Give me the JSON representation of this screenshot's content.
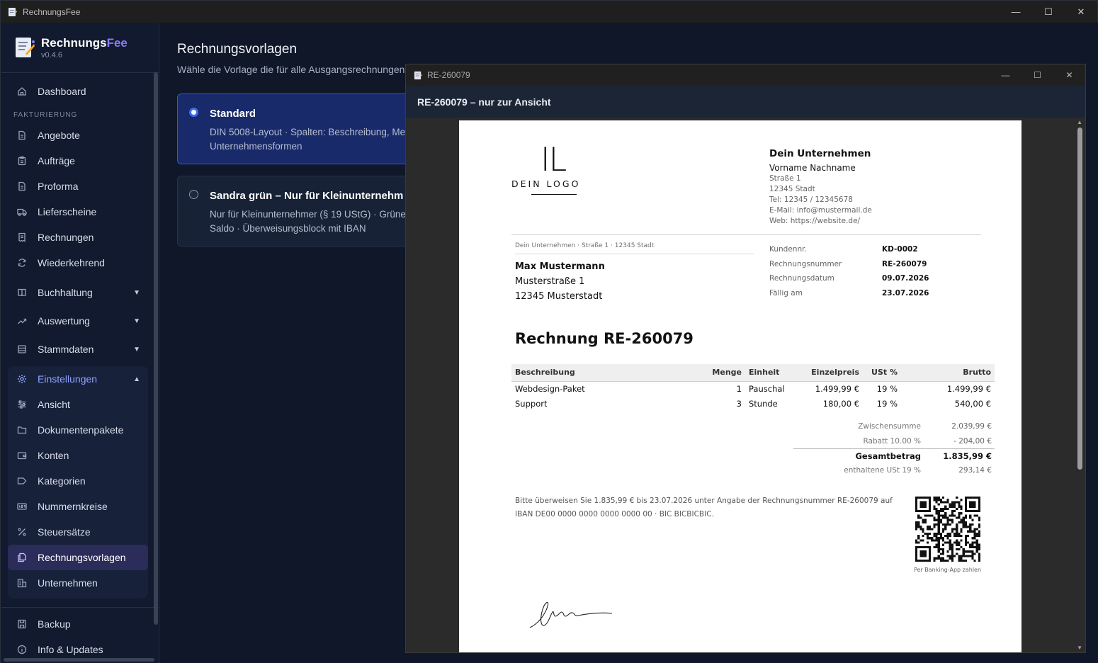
{
  "app": {
    "window_title": "RechnungsFee",
    "brand_primary": "Rechnungs",
    "brand_accent": "Fee",
    "version": "v0.4.6",
    "accent_color": "#8b7cf6"
  },
  "sidebar": {
    "top_items": [
      {
        "label": "Dashboard",
        "icon": "home-icon"
      }
    ],
    "section_label": "FAKTURIERUNG",
    "billing_items": [
      {
        "label": "Angebote",
        "icon": "document-icon"
      },
      {
        "label": "Aufträge",
        "icon": "clipboard-icon"
      },
      {
        "label": "Proforma",
        "icon": "document-icon"
      },
      {
        "label": "Lieferscheine",
        "icon": "truck-icon"
      },
      {
        "label": "Rechnungen",
        "icon": "receipt-icon"
      },
      {
        "label": "Wiederkehrend",
        "icon": "refresh-icon"
      }
    ],
    "collapsible_items": [
      {
        "label": "Buchhaltung",
        "icon": "book-icon"
      },
      {
        "label": "Auswertung",
        "icon": "trend-icon"
      },
      {
        "label": "Stammdaten",
        "icon": "database-icon"
      }
    ],
    "settings": {
      "label": "Einstellungen",
      "children": [
        {
          "label": "Ansicht",
          "icon": "sliders-icon"
        },
        {
          "label": "Dokumentenpakete",
          "icon": "folder-icon"
        },
        {
          "label": "Konten",
          "icon": "wallet-icon"
        },
        {
          "label": "Kategorien",
          "icon": "tag-icon"
        },
        {
          "label": "Nummernkreise",
          "icon": "counter-icon"
        },
        {
          "label": "Steuersätze",
          "icon": "percent-icon"
        },
        {
          "label": "Rechnungsvorlagen",
          "icon": "copy-icon"
        },
        {
          "label": "Unternehmen",
          "icon": "building-icon"
        }
      ]
    },
    "bottom_items": [
      {
        "label": "Backup",
        "icon": "save-icon"
      },
      {
        "label": "Info & Updates",
        "icon": "info-icon"
      }
    ]
  },
  "main": {
    "title": "Rechnungsvorlagen",
    "subtitle": "Wähle die Vorlage die für alle Ausgangsrechnungen",
    "templates": [
      {
        "name": "Standard",
        "desc_line1": "DIN 5008-Layout · Spalten: Beschreibung, Me",
        "desc_line2": "Unternehmensformen",
        "selected": true
      },
      {
        "name": "Sandra grün – Nur für Kleinunternehm",
        "desc_line1": "Nur für Kleinunternehmer (§ 19 UStG) · Grüne",
        "desc_line2": "Saldo · Überweisungsblock mit IBAN",
        "selected": false
      }
    ]
  },
  "viewer": {
    "window_title": "RE-260079",
    "header": "RE-260079 – nur zur Ansicht"
  },
  "invoice": {
    "logo_mark": "IL",
    "logo_text": "DEIN LOGO",
    "company_name": "Dein Unternehmen",
    "company_person": "Vorname Nachname",
    "company_lines": [
      "Straße 1",
      "12345 Stadt",
      "Tel: 12345 / 12345678",
      "E-Mail: info@mustermail.de",
      "Web: https://website.de/"
    ],
    "sender_line": "Dein Unternehmen  ·  Straße 1  ·  12345 Stadt",
    "recipient_name": "Max Mustermann",
    "recipient_street": "Musterstraße 1",
    "recipient_city": "12345 Musterstadt",
    "meta": [
      {
        "key": "Kundennr.",
        "value": "KD-0002"
      },
      {
        "key": "Rechnungsnummer",
        "value": "RE-260079"
      },
      {
        "key": "Rechnungsdatum",
        "value": "09.07.2026"
      },
      {
        "key": "Fällig am",
        "value": "23.07.2026"
      }
    ],
    "title": "Rechnung RE-260079",
    "columns": [
      "Beschreibung",
      "Menge",
      "Einheit",
      "Einzelpreis",
      "USt %",
      "Brutto"
    ],
    "items": [
      {
        "desc": "Webdesign-Paket",
        "qty": "1",
        "unit": "Pauschal",
        "price": "1.499,99 €",
        "vat": "19 %",
        "gross": "1.499,99 €"
      },
      {
        "desc": "Support",
        "qty": "3",
        "unit": "Stunde",
        "price": "180,00 €",
        "vat": "19 %",
        "gross": "540,00 €"
      }
    ],
    "totals": [
      {
        "key": "Zwischensumme",
        "value": "2.039,99 €"
      },
      {
        "key": "Rabatt 10.00 %",
        "value": "- 204,00 €"
      }
    ],
    "grand_total": {
      "key": "Gesamtbetrag",
      "value": "1.835,99 €"
    },
    "vat_included": {
      "key": "enthaltene USt 19 %",
      "value": "293,14 €"
    },
    "payment_line1": "Bitte überweisen Sie 1.835,99 € bis 23.07.2026 unter Angabe der Rechnungsnummer RE-260079 auf",
    "payment_line2": "IBAN DE00 0000 0000 0000 0000 00  ·  BIC BICBICBIC.",
    "qr_caption": "Per Banking-App zahlen"
  }
}
